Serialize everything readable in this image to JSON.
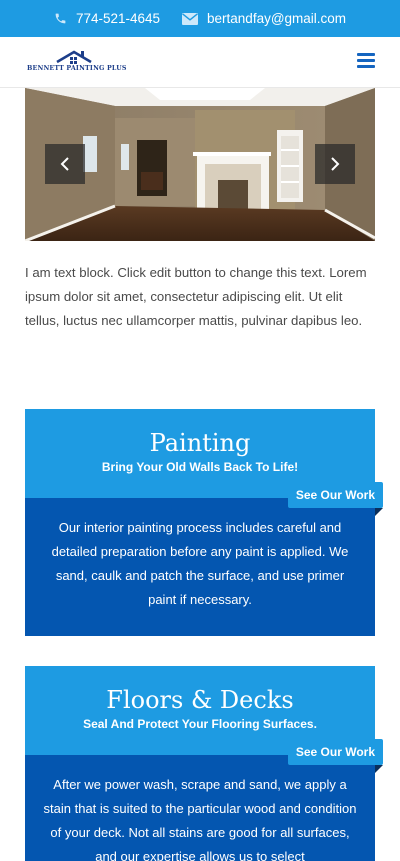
{
  "topbar": {
    "phone": "774-521-4645",
    "email": "bertandfay@gmail.com",
    "phone_icon": "phone-icon",
    "email_icon": "envelope-icon"
  },
  "header": {
    "logo_text": "BENNETT PAINTING PLUS",
    "menu_icon": "hamburger-icon"
  },
  "slider": {
    "prev_icon": "chevron-left-icon",
    "next_icon": "chevron-right-icon"
  },
  "text_block": "I am text block. Click edit button to change this text. Lorem ipsum dolor sit amet, consectetur adipiscing elit. Ut elit tellus, luctus nec ullamcorper mattis, pulvinar dapibus leo.",
  "services": [
    {
      "title": "Painting",
      "subtitle": "Bring Your Old Walls Back To Life!",
      "button": "See Our Work",
      "description": "Our interior painting process includes careful and detailed preparation before any paint is applied. We sand, caulk and patch the surface, and use primer paint if necessary."
    },
    {
      "title": "Floors & Decks",
      "subtitle": "Seal And Protect Your Flooring Surfaces.",
      "button": "See Our Work",
      "description": "After we power wash, scrape and sand, we apply a stain that is suited to the particular wood and condition of your deck. Not all stains are good for all surfaces, and our expertise allows us to select"
    }
  ],
  "colors": {
    "primary_blue": "#1e9be2",
    "dark_blue": "#0456b0",
    "logo_navy": "#1d3e8a"
  }
}
